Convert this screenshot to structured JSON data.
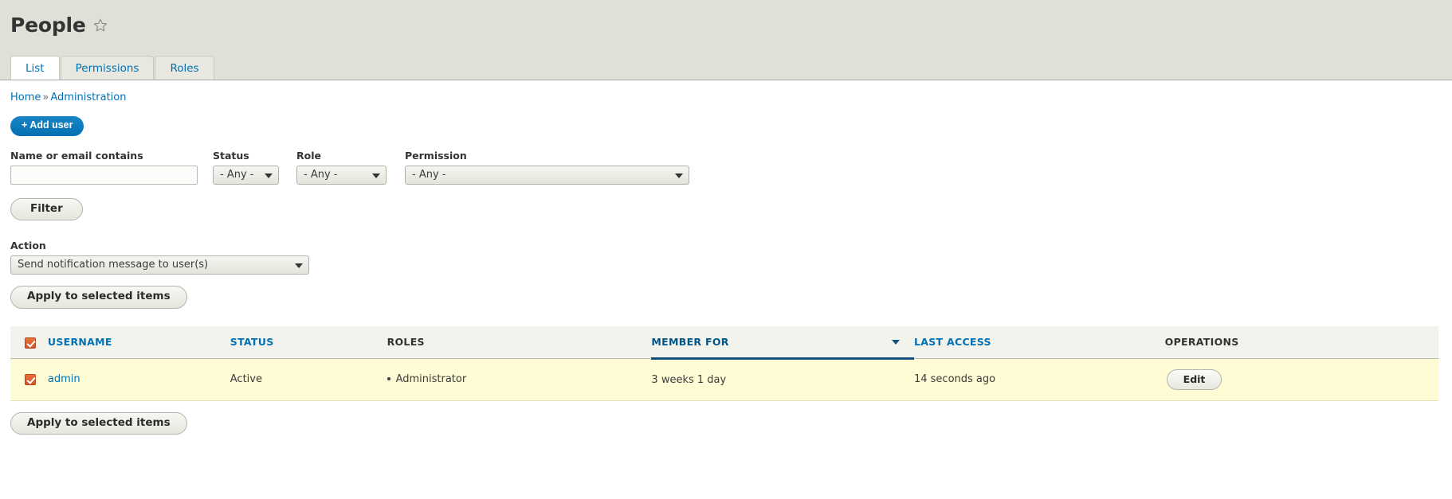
{
  "page": {
    "title": "People",
    "favorite_icon": "star-outline-icon"
  },
  "tabs": [
    {
      "label": "List",
      "active": true
    },
    {
      "label": "Permissions",
      "active": false
    },
    {
      "label": "Roles",
      "active": false
    }
  ],
  "breadcrumb": {
    "home": "Home",
    "separator": "»",
    "current": "Administration"
  },
  "actions_top": {
    "add_user_label": "+ Add user"
  },
  "filters": {
    "name_label": "Name or email contains",
    "name_value": "",
    "name_placeholder": "",
    "status_label": "Status",
    "status_value": "- Any -",
    "role_label": "Role",
    "role_value": "- Any -",
    "permission_label": "Permission",
    "permission_value": "- Any -",
    "filter_button": "Filter"
  },
  "bulk": {
    "action_label": "Action",
    "action_value": "Send notification message to user(s)",
    "apply_label": "Apply to selected items"
  },
  "table": {
    "columns": [
      {
        "label": "USERNAME",
        "sortable": true,
        "sorted": false
      },
      {
        "label": "STATUS",
        "sortable": true,
        "sorted": false
      },
      {
        "label": "ROLES",
        "sortable": false,
        "sorted": false
      },
      {
        "label": "MEMBER FOR",
        "sortable": true,
        "sorted": true,
        "direction": "desc"
      },
      {
        "label": "LAST ACCESS",
        "sortable": true,
        "sorted": false
      },
      {
        "label": "OPERATIONS",
        "sortable": false,
        "sorted": false
      }
    ],
    "select_all_checked": true,
    "rows": [
      {
        "checked": true,
        "username": "admin",
        "status": "Active",
        "roles": "Administrator",
        "member_for": "3 weeks 1 day",
        "last_access": "14 seconds ago",
        "operation": "Edit"
      }
    ]
  },
  "colors": {
    "link": "#0071b3",
    "header_band": "#e0e0d8",
    "row_highlight": "#fffbd4",
    "checkbox": "#d2532a",
    "sorted_underline": "#14507d"
  }
}
